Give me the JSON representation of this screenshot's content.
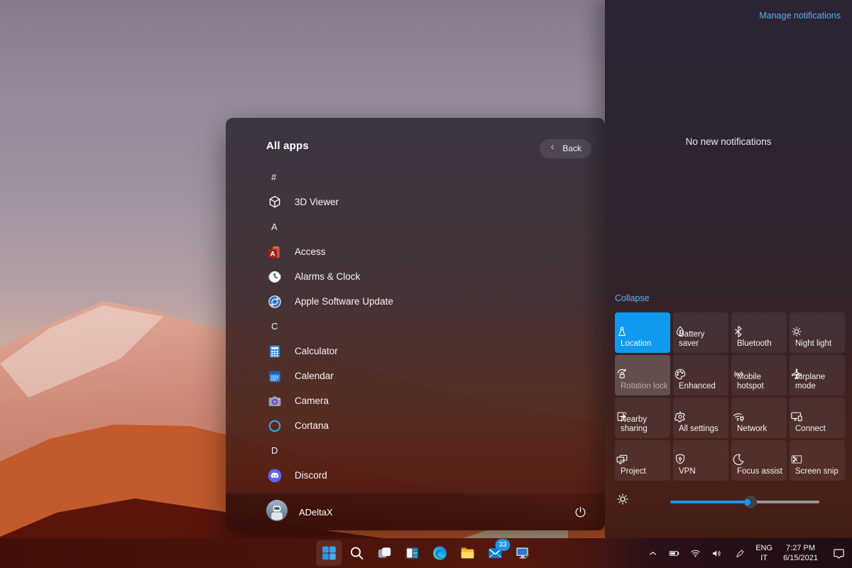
{
  "start_menu": {
    "title": "All apps",
    "back_label": "Back",
    "sections": [
      {
        "letter": "#",
        "apps": [
          {
            "name": "3D Viewer",
            "icon": "3d-viewer-icon"
          }
        ]
      },
      {
        "letter": "A",
        "apps": [
          {
            "name": "Access",
            "icon": "access-icon"
          },
          {
            "name": "Alarms & Clock",
            "icon": "alarms-clock-icon"
          },
          {
            "name": "Apple Software Update",
            "icon": "apple-software-update-icon"
          }
        ]
      },
      {
        "letter": "C",
        "apps": [
          {
            "name": "Calculator",
            "icon": "calculator-icon"
          },
          {
            "name": "Calendar",
            "icon": "calendar-icon"
          },
          {
            "name": "Camera",
            "icon": "camera-icon"
          },
          {
            "name": "Cortana",
            "icon": "cortana-icon"
          }
        ]
      },
      {
        "letter": "D",
        "apps": [
          {
            "name": "Discord",
            "icon": "discord-icon"
          }
        ]
      }
    ],
    "user_name": "ADeltaX"
  },
  "action_center": {
    "manage_link": "Manage notifications",
    "empty_text": "No new notifications",
    "collapse_link": "Collapse",
    "tiles": [
      {
        "label": "Location",
        "icon": "location-icon",
        "state": "active"
      },
      {
        "label": "Battery saver",
        "icon": "battery-saver-icon",
        "state": "normal"
      },
      {
        "label": "Bluetooth",
        "icon": "bluetooth-icon",
        "state": "normal"
      },
      {
        "label": "Night light",
        "icon": "night-light-icon",
        "state": "normal"
      },
      {
        "label": "Rotation lock",
        "icon": "rotation-lock-icon",
        "state": "disabled"
      },
      {
        "label": "Enhanced",
        "icon": "enhanced-icon",
        "state": "normal"
      },
      {
        "label": "Mobile hotspot",
        "icon": "mobile-hotspot-icon",
        "state": "normal"
      },
      {
        "label": "Airplane mode",
        "icon": "airplane-mode-icon",
        "state": "normal"
      },
      {
        "label": "Nearby sharing",
        "icon": "nearby-sharing-icon",
        "state": "normal"
      },
      {
        "label": "All settings",
        "icon": "all-settings-icon",
        "state": "normal"
      },
      {
        "label": "Network",
        "icon": "network-icon",
        "state": "normal"
      },
      {
        "label": "Connect",
        "icon": "connect-icon",
        "state": "normal"
      },
      {
        "label": "Project",
        "icon": "project-icon",
        "state": "normal"
      },
      {
        "label": "VPN",
        "icon": "vpn-icon",
        "state": "normal"
      },
      {
        "label": "Focus assist",
        "icon": "focus-assist-icon",
        "state": "normal"
      },
      {
        "label": "Screen snip",
        "icon": "screen-snip-icon",
        "state": "normal"
      }
    ],
    "brightness_percent": 54
  },
  "taskbar": {
    "apps": [
      {
        "icon": "start-icon",
        "active": true
      },
      {
        "icon": "search-icon"
      },
      {
        "icon": "task-view-icon"
      },
      {
        "icon": "panel-layout-icon"
      },
      {
        "icon": "edge-icon"
      },
      {
        "icon": "file-explorer-icon"
      },
      {
        "icon": "mail-icon",
        "badge": "33"
      },
      {
        "icon": "remote-desktop-icon"
      }
    ],
    "tray": {
      "language_top": "ENG",
      "language_bottom": "IT",
      "time": "7:27 PM",
      "date": "6/15/2021"
    }
  },
  "colors": {
    "accent_blue": "#0f9af0",
    "link_blue": "#58b0f0"
  }
}
